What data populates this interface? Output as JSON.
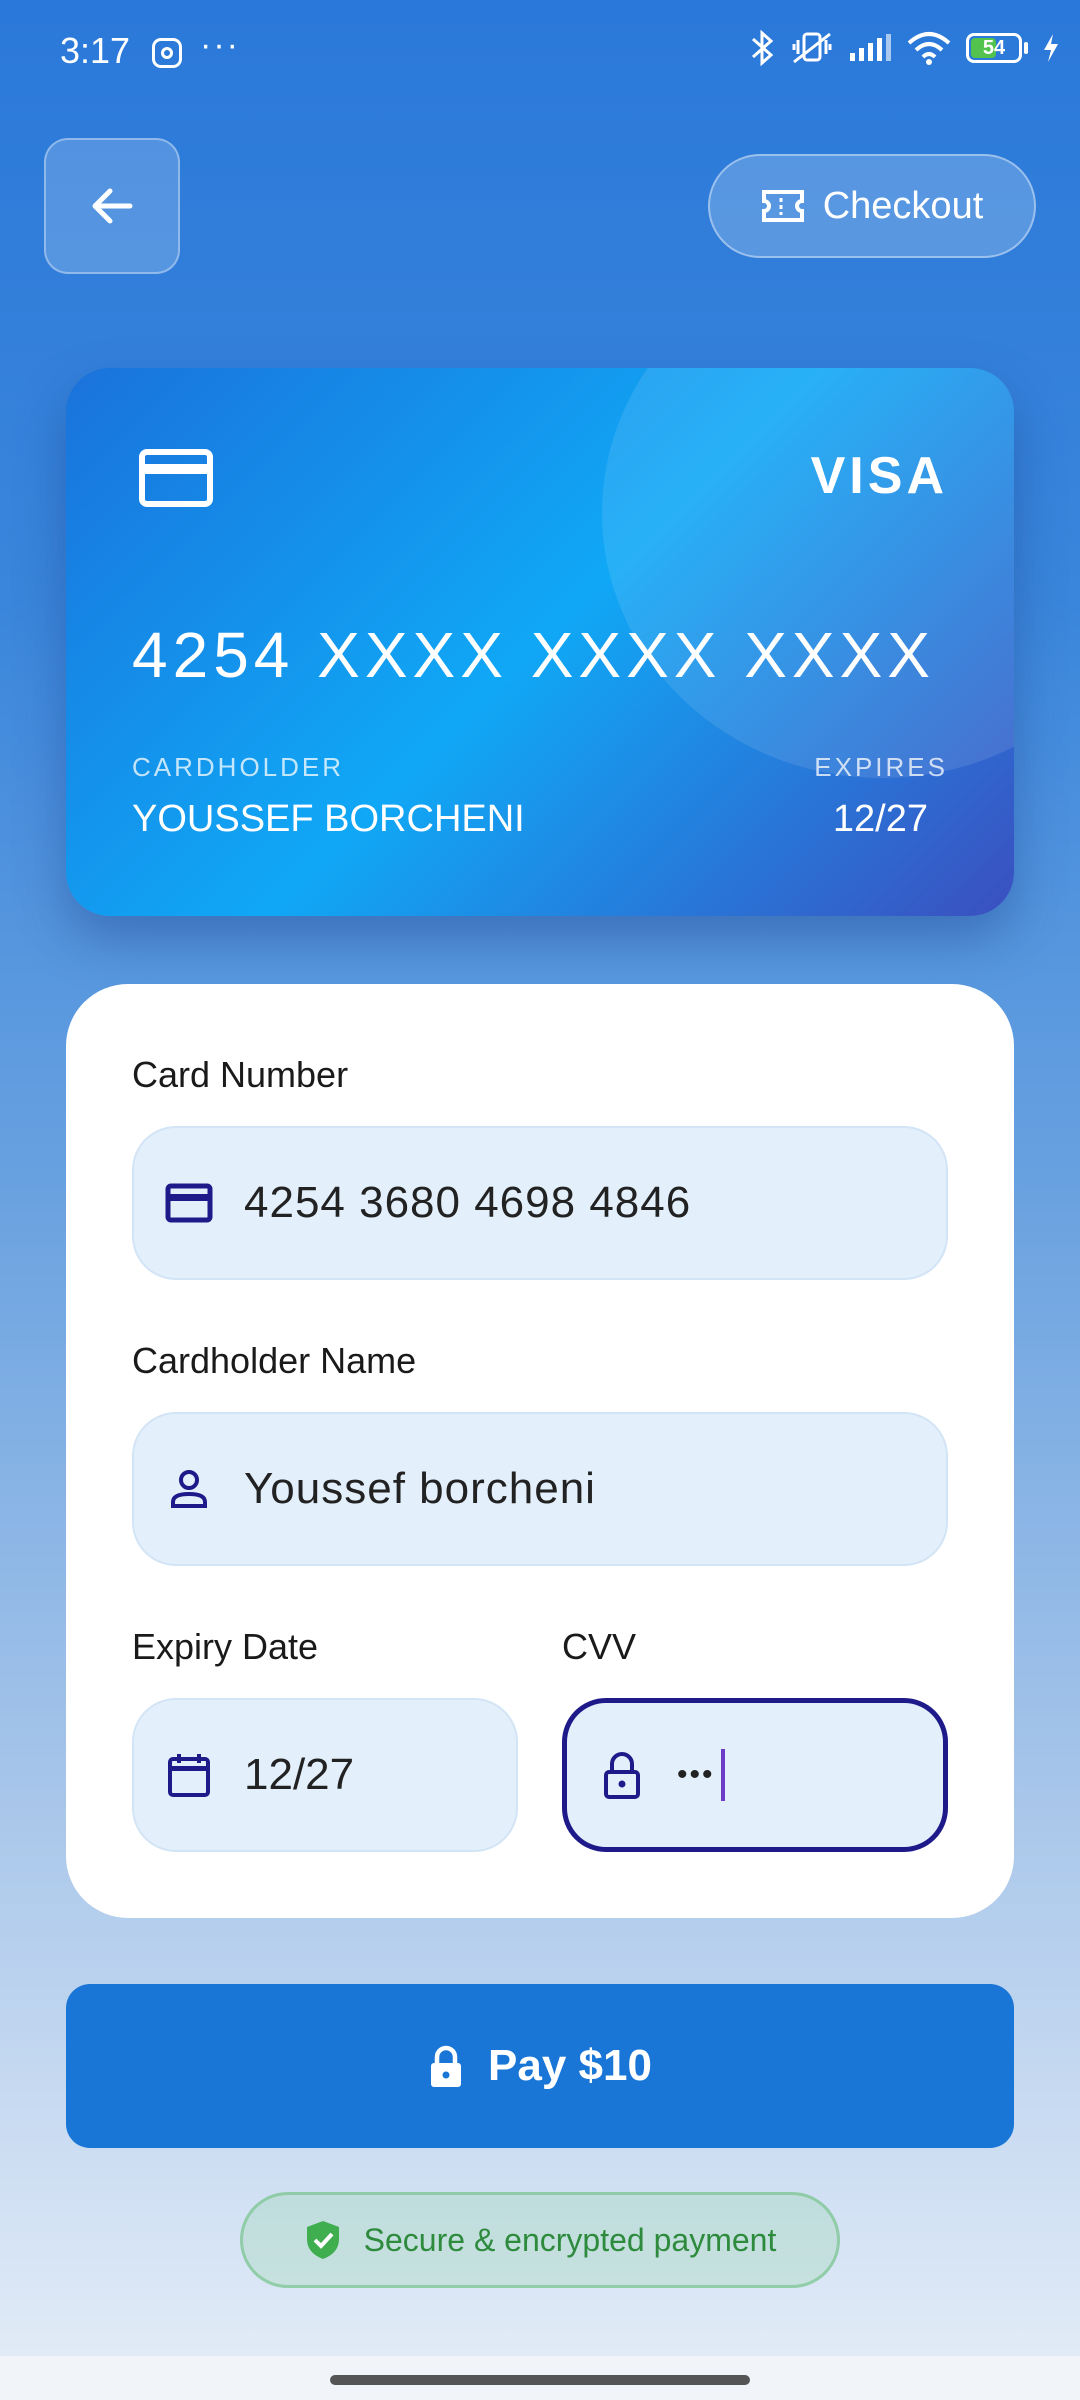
{
  "status_bar": {
    "time": "3:17",
    "more": "···",
    "battery": "54"
  },
  "header": {
    "checkout_label": "Checkout"
  },
  "card": {
    "brand": "VISA",
    "number": "4254 XXXX XXXX XXXX",
    "holder_label": "CARDHOLDER",
    "holder": "YOUSSEF BORCHENI",
    "expires_label": "EXPIRES",
    "expires": "12/27"
  },
  "form": {
    "card_number_label": "Card Number",
    "card_number_value": "4254 3680 4698 4846",
    "name_label": "Cardholder Name",
    "name_value": "Youssef borcheni",
    "expiry_label": "Expiry Date",
    "expiry_value": "12/27",
    "cvv_label": "CVV",
    "cvv_value": "•••"
  },
  "pay": {
    "label": "Pay $10"
  },
  "secure": {
    "label": "Secure & encrypted payment"
  },
  "colors": {
    "primary": "#1976d6",
    "accent": "#1f1a8a",
    "field_bg": "#e3f0fb",
    "secure_text": "#2e8b3d"
  }
}
